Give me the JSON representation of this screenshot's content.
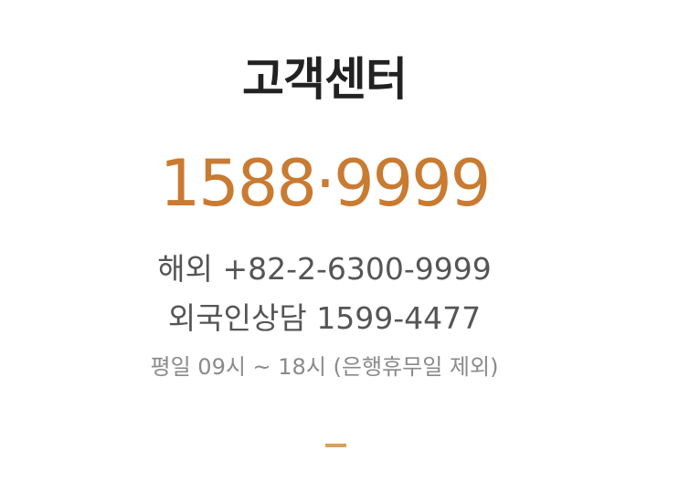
{
  "title": "고객센터",
  "main_phone": "1588·9999",
  "overseas": {
    "label": "해외",
    "number": "+82-2-6300-9999"
  },
  "foreign": {
    "label": "외국인상담",
    "number": "1599-4477"
  },
  "hours": "평일 09시 ~ 18시 (은행휴무일 제외)",
  "colors": {
    "accent": "#c97b32",
    "accent_bar": "#d9a15a",
    "title": "#222222"
  }
}
